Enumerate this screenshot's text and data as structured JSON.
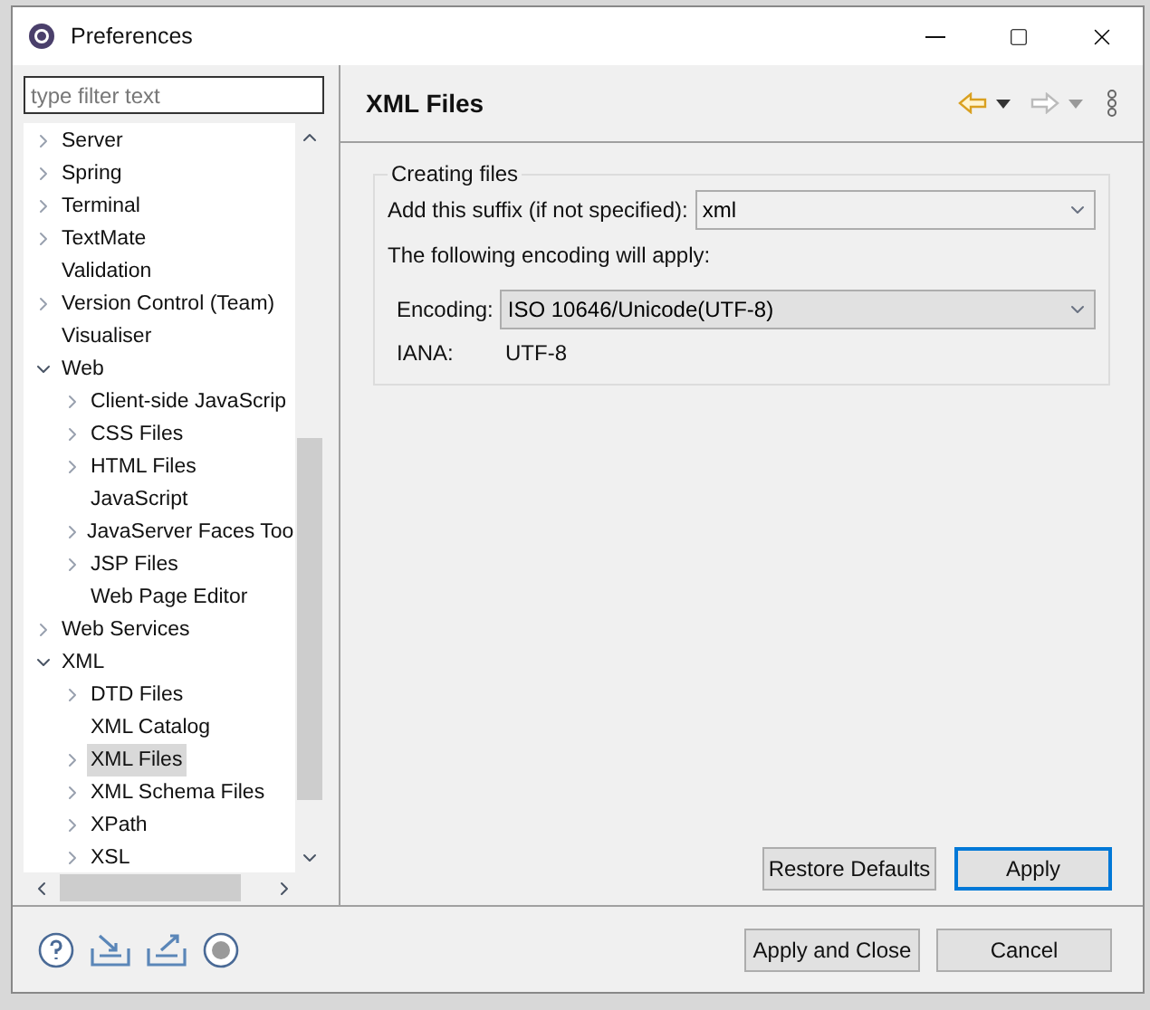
{
  "window": {
    "title": "Preferences"
  },
  "filter": {
    "placeholder": "type filter text"
  },
  "tree": [
    {
      "label": "Server",
      "kind": "folder",
      "expanded": false,
      "selected": false
    },
    {
      "label": "Spring",
      "kind": "folder",
      "expanded": false,
      "selected": false
    },
    {
      "label": "Terminal",
      "kind": "folder",
      "expanded": false,
      "selected": false
    },
    {
      "label": "TextMate",
      "kind": "folder",
      "expanded": false,
      "selected": false
    },
    {
      "label": "Validation",
      "kind": "leaf",
      "selected": false
    },
    {
      "label": "Version Control (Team)",
      "kind": "folder",
      "expanded": false,
      "selected": false
    },
    {
      "label": "Visualiser",
      "kind": "leaf",
      "selected": false
    },
    {
      "label": "Web",
      "kind": "folder",
      "expanded": true,
      "selected": false,
      "children": [
        {
          "label": "Client-side JavaScrip",
          "kind": "folder",
          "expanded": false,
          "selected": false
        },
        {
          "label": "CSS Files",
          "kind": "folder",
          "expanded": false,
          "selected": false
        },
        {
          "label": "HTML Files",
          "kind": "folder",
          "expanded": false,
          "selected": false
        },
        {
          "label": "JavaScript",
          "kind": "leaf",
          "selected": false
        },
        {
          "label": "JavaServer Faces Too",
          "kind": "folder",
          "expanded": false,
          "selected": false
        },
        {
          "label": "JSP Files",
          "kind": "folder",
          "expanded": false,
          "selected": false
        },
        {
          "label": "Web Page Editor",
          "kind": "leaf",
          "selected": false
        }
      ]
    },
    {
      "label": "Web Services",
      "kind": "folder",
      "expanded": false,
      "selected": false
    },
    {
      "label": "XML",
      "kind": "folder",
      "expanded": true,
      "selected": false,
      "children": [
        {
          "label": "DTD Files",
          "kind": "folder",
          "expanded": false,
          "selected": false
        },
        {
          "label": "XML Catalog",
          "kind": "leaf",
          "selected": false
        },
        {
          "label": "XML Files",
          "kind": "folder",
          "expanded": false,
          "selected": true
        },
        {
          "label": "XML Schema Files",
          "kind": "folder",
          "expanded": false,
          "selected": false
        },
        {
          "label": "XPath",
          "kind": "folder",
          "expanded": false,
          "selected": false
        },
        {
          "label": "XSL",
          "kind": "folder",
          "expanded": false,
          "selected": false
        }
      ]
    }
  ],
  "page": {
    "title": "XML Files",
    "group": {
      "title": "Creating files",
      "suffix_label": "Add this suffix (if not specified):",
      "suffix_value": "xml",
      "encoding_note": "The following encoding will apply:",
      "encoding_label": "Encoding:",
      "encoding_value": "ISO 10646/Unicode(UTF-8)",
      "iana_label": "IANA:",
      "iana_value": "UTF-8"
    },
    "buttons": [
      {
        "label": "Restore Defaults",
        "default": false
      },
      {
        "label": "Apply",
        "default": true
      }
    ]
  },
  "footer_buttons": [
    {
      "label": "Apply and Close",
      "default": false
    },
    {
      "label": "Cancel",
      "default": false
    }
  ]
}
